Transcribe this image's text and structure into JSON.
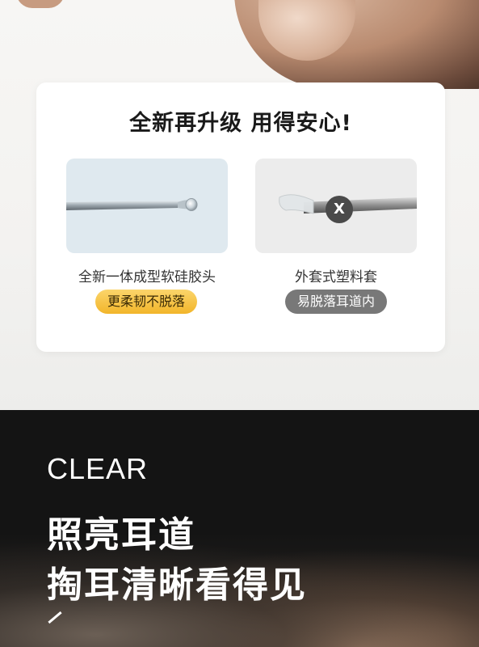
{
  "card": {
    "title": "全新再升级  用得安心!",
    "new_product": {
      "caption": "全新一体成型软硅胶头",
      "badge": "更柔韧不脱落"
    },
    "old_product": {
      "caption": "外套式塑料套",
      "badge": "易脱落耳道内",
      "mark": "X"
    }
  },
  "banner": {
    "eyebrow": "CLEAR",
    "headline_line1": "照亮耳道",
    "headline_line2": "掏耳清晰看得见"
  },
  "colors": {
    "good_badge": "#f2b52a",
    "bad_badge": "#787878",
    "dark_bg": "#141414"
  }
}
